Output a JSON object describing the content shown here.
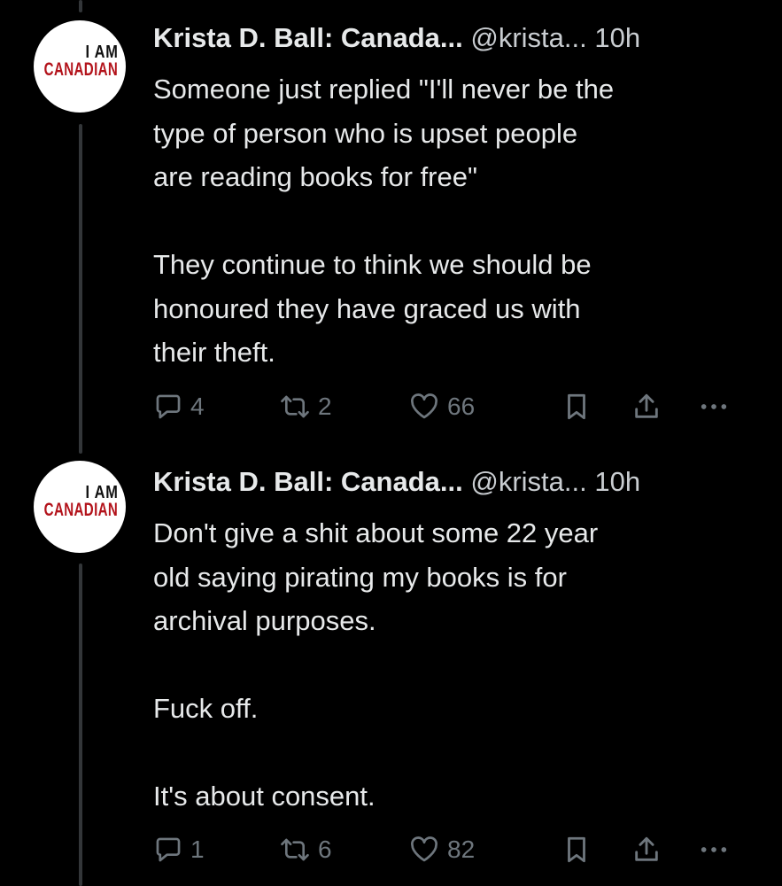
{
  "tweets": [
    {
      "avatar": {
        "line1": "I AM",
        "line2": "CANADIAN"
      },
      "name": "Krista D. Ball: Canada...",
      "handle": "@krista...",
      "time": "10h",
      "paragraphs": [
        [
          "Someone just replied \"I'll never be the",
          "type of person who is upset people",
          "are reading books for free\""
        ],
        [
          "They continue to think we should be",
          "honoured they have graced us with",
          "their theft."
        ]
      ],
      "actions": {
        "replies": "4",
        "retweets": "2",
        "likes": "66"
      }
    },
    {
      "avatar": {
        "line1": "I AM",
        "line2": "CANADIAN"
      },
      "name": "Krista D. Ball: Canada...",
      "handle": "@krista...",
      "time": "10h",
      "paragraphs": [
        [
          "Don't give a shit about some 22 year",
          "old saying pirating my books is for",
          "archival purposes."
        ],
        [
          "Fuck off."
        ],
        [
          "It's about consent."
        ]
      ],
      "actions": {
        "replies": "1",
        "retweets": "6",
        "likes": "82"
      }
    }
  ],
  "icons": {
    "reply": "reply-icon",
    "retweet": "retweet-icon",
    "like": "heart-icon",
    "bookmark": "bookmark-icon",
    "share": "share-icon",
    "more": "more-icon"
  },
  "colors": {
    "background": "#000000",
    "text": "#e7e9ea",
    "muted": "#6e767d",
    "thread_line": "#333639",
    "avatar_red": "#b3131b"
  }
}
